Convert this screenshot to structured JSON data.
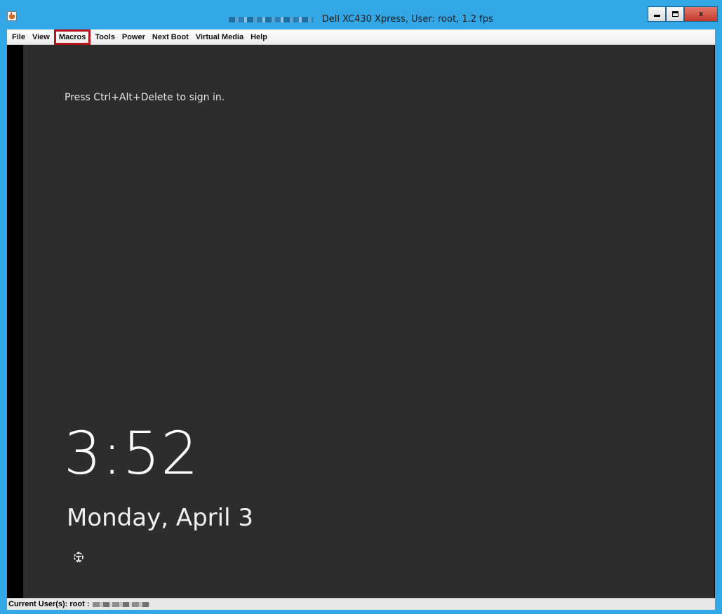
{
  "window": {
    "title": "Dell XC430 Xpress, User: root, 1.2 fps",
    "controls": {
      "minimize_icon": "minimize-icon",
      "maximize_icon": "maximize-icon",
      "close_label": "x"
    }
  },
  "menubar": {
    "items": [
      {
        "label": "File"
      },
      {
        "label": "View"
      },
      {
        "label": "Macros",
        "highlighted": true
      },
      {
        "label": "Tools"
      },
      {
        "label": "Power"
      },
      {
        "label": "Next Boot"
      },
      {
        "label": "Virtual Media"
      },
      {
        "label": "Help"
      }
    ],
    "highlight_color": "#b4121c"
  },
  "remote_screen": {
    "prompt": "Press Ctrl+Alt+Delete to sign in.",
    "time": "3:52",
    "date": "Monday, April 3",
    "accessibility_icon": "ease-of-access-icon",
    "background_color": "#2d2d2d"
  },
  "statusbar": {
    "text": "Current User(s): root :"
  },
  "colors": {
    "titlebar": "#33a7e5",
    "close_button": "#c33a2a"
  }
}
